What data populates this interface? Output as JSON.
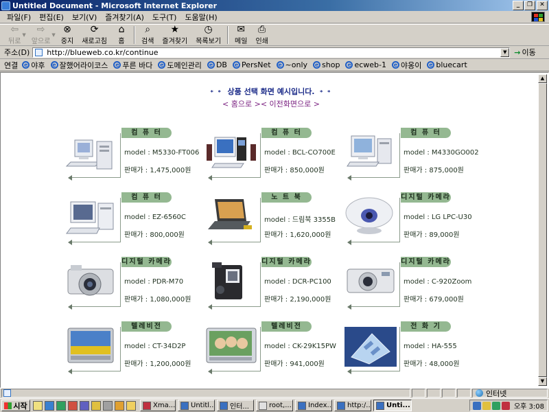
{
  "window": {
    "title": "Untitled Document - Microsoft Internet Explorer"
  },
  "menubar": {
    "items": [
      "파일(F)",
      "편집(E)",
      "보기(V)",
      "즐겨찾기(A)",
      "도구(T)",
      "도움말(H)"
    ]
  },
  "toolbar": {
    "back": "뒤로",
    "forward": "앞으로",
    "stop": "중지",
    "refresh": "새로고침",
    "home": "홈",
    "search": "검색",
    "favorites": "즐겨찾기",
    "history": "목록보기",
    "mail": "메일",
    "print": "인쇄"
  },
  "address": {
    "label": "주소(D)",
    "url": "http://blueweb.co.kr/continue",
    "go": "이동"
  },
  "links": {
    "label": "연결",
    "items": [
      "야후",
      "잘했어라이코스",
      "푸른 바다",
      "도메인관리",
      "DB",
      "PersNet",
      "~only",
      "shop",
      "ecweb-1",
      "야옹이",
      "bluecart"
    ]
  },
  "page": {
    "heading": "상품 선택 화면 예시입니다.",
    "heading_stars": "* *",
    "nav_home": "< 홈으로 >",
    "nav_prev": "< 이전화면으로 >"
  },
  "products": [
    {
      "category": "컴 퓨 터",
      "model": "model : M5330-FT006",
      "price": "판매가 : 1,475,000원",
      "icon": "desktop-computer"
    },
    {
      "category": "컴 퓨 터",
      "model": "model : BCL-CO700E",
      "price": "판매가 : 850,000원",
      "icon": "desktop-computer-speakers"
    },
    {
      "category": "컴 퓨 터",
      "model": "model : M4330GO002",
      "price": "판매가 : 875,000원",
      "icon": "desktop-computer"
    },
    {
      "category": "컴 퓨 터",
      "model": "model : EZ-6560C",
      "price": "판매가 : 800,000원",
      "icon": "desktop-computer"
    },
    {
      "category": "노 트 북",
      "model": "model : 드림북 3355B",
      "price": "판매가 : 1,620,000원",
      "icon": "laptop"
    },
    {
      "category": "디지털 카메라",
      "model": "model : LG LPC-U30",
      "price": "판매가 : 89,000원",
      "icon": "webcam"
    },
    {
      "category": "디지털 카메라",
      "model": "model : PDR-M70",
      "price": "판매가 : 1,080,000원",
      "icon": "digital-camera"
    },
    {
      "category": "디지털 카메라",
      "model": "model : DCR-PC100",
      "price": "판매가 : 2,190,000원",
      "icon": "camcorder"
    },
    {
      "category": "디지털 카메라",
      "model": "model : C-920Zoom",
      "price": "판매가 : 679,000원",
      "icon": "compact-camera"
    },
    {
      "category": "텔레비전",
      "model": "model : CT-34D2P",
      "price": "판매가 : 1,200,000원",
      "icon": "television"
    },
    {
      "category": "텔레비전",
      "model": "model : CK-29K15PW",
      "price": "판매가 : 941,000원",
      "icon": "television"
    },
    {
      "category": "전 화 기",
      "model": "model : HA-555",
      "price": "판매가 : 48,000원",
      "icon": "telephone"
    }
  ],
  "statusbar": {
    "zone": "인터넷"
  },
  "taskbar": {
    "start": "시작",
    "tasks": [
      "Xma...",
      "Untitl...",
      "인터...",
      "root,...",
      "Index...",
      "http:/...",
      "Unti..."
    ],
    "active_task_index": 6,
    "clock": "오후 3:08"
  },
  "colors": {
    "tab_green": "#94b891",
    "heading_blue": "#1a2a88",
    "nav_purple": "#7a2080"
  }
}
